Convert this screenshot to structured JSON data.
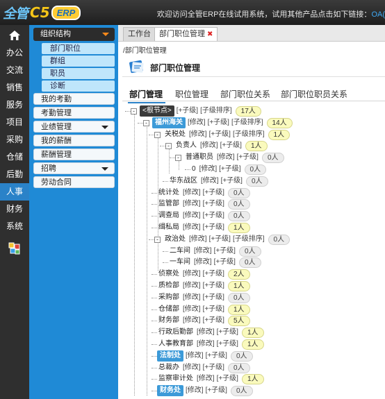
{
  "header": {
    "logo": {
      "part1": "全管",
      "part2": "C5",
      "part3": "ERP"
    },
    "welcome_text": "欢迎访问全管ERP在线试用系统，试用其他产品点击如下链接：",
    "welcome_link": "OA("
  },
  "leftbar": {
    "items": [
      {
        "label": "办公"
      },
      {
        "label": "交流"
      },
      {
        "label": "销售"
      },
      {
        "label": "服务"
      },
      {
        "label": "项目"
      },
      {
        "label": "采购"
      },
      {
        "label": "仓储"
      },
      {
        "label": "后勤"
      },
      {
        "label": "人事",
        "active": true
      },
      {
        "label": "财务"
      },
      {
        "label": "系统"
      }
    ]
  },
  "menu": {
    "org_structure": "组织结构",
    "sub_items": [
      "部门职位",
      "群组",
      "职员",
      "诊断"
    ],
    "items_a": [
      "我的考勤",
      "考勤管理"
    ],
    "perf_mgmt": "业绩管理",
    "items_b": [
      "我的薪酬",
      "薪酬管理"
    ],
    "recruit": "招聘",
    "contract": "劳动合同"
  },
  "tabs": {
    "workbench": "工作台",
    "current": "部门职位管理",
    "close": "✖"
  },
  "breadcrumb": "/部门职位管理",
  "page_title": "部门职位管理",
  "subtabs": [
    "部门管理",
    "职位管理",
    "部门职位关系",
    "部门职位职员关系"
  ],
  "tree": {
    "toggle_expanded": "-",
    "actions": {
      "edit": "[修改]",
      "add_child": "[+子级]",
      "sort": "[子级排序]"
    },
    "rows": [
      {
        "name": "<根节点>",
        "count": "17人"
      },
      {
        "name": "福州海关",
        "count": "14人"
      },
      {
        "name": "关税处",
        "count": "1人"
      },
      {
        "name": "负责人",
        "count": "1人"
      },
      {
        "name": "普通职员",
        "count": "0人"
      },
      {
        "name": "0",
        "count": "0人"
      },
      {
        "name": "华东战区",
        "count": "0人"
      },
      {
        "name": "统计处",
        "count": "0人"
      },
      {
        "name": "监管部",
        "count": "0人"
      },
      {
        "name": "调查局",
        "count": "0人"
      },
      {
        "name": "缉私局",
        "count": "1人"
      },
      {
        "name": "政治处",
        "count": "0人"
      },
      {
        "name": "二车间",
        "count": "0人"
      },
      {
        "name": "一车间",
        "count": "0人"
      },
      {
        "name": "侦察处",
        "count": "2人"
      },
      {
        "name": "质检部",
        "count": "1人"
      },
      {
        "name": "采购部",
        "count": "0人"
      },
      {
        "name": "仓储部",
        "count": "1人"
      },
      {
        "name": "财务部",
        "count": "5人"
      },
      {
        "name": "行政后勤部",
        "count": "1人"
      },
      {
        "name": "人事教育部",
        "count": "1人"
      },
      {
        "name": "法制处",
        "count": "0人"
      },
      {
        "name": "总裁办",
        "count": "0人"
      },
      {
        "name": "监察审计处",
        "count": "1人"
      },
      {
        "name": "财务处",
        "count": "0人"
      }
    ]
  }
}
